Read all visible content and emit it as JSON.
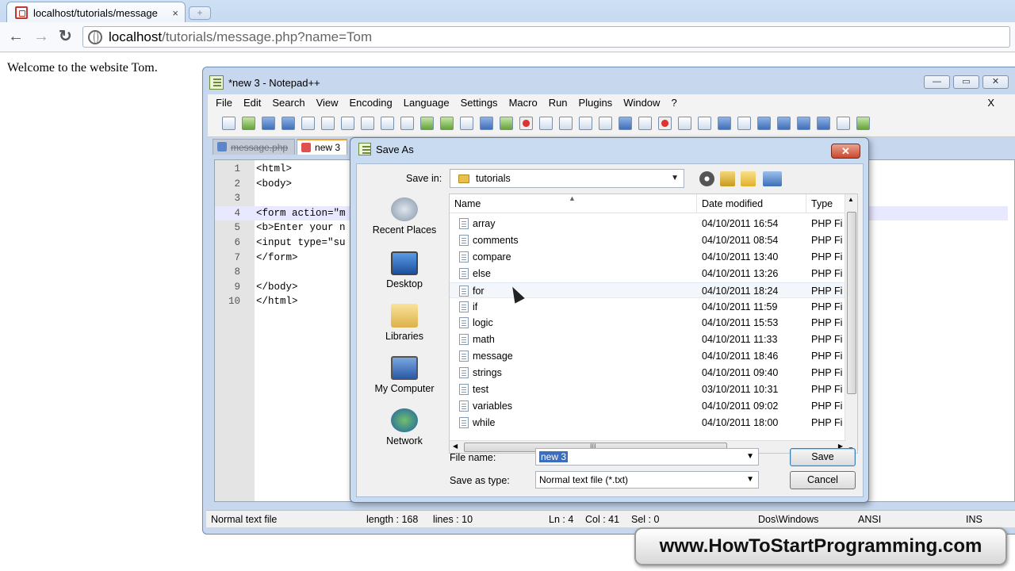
{
  "browser": {
    "tab_title": "localhost/tutorials/message",
    "tab_close": "×",
    "new_tab": "+",
    "back": "←",
    "forward": "→",
    "reload": "↻",
    "url_host": "localhost",
    "url_path": "/tutorials/message.php?name=Tom"
  },
  "page": {
    "welcome": "Welcome to the website Tom."
  },
  "npp": {
    "title": "*new 3 - Notepad++",
    "win_min": "—",
    "win_max": "▭",
    "win_close": "✕",
    "menu": [
      "File",
      "Edit",
      "Search",
      "View",
      "Encoding",
      "Language",
      "Settings",
      "Macro",
      "Run",
      "Plugins",
      "Window",
      "?"
    ],
    "menu_close": "X",
    "tabs": [
      {
        "label": "message.php"
      },
      {
        "label": "new 3"
      }
    ],
    "lines": [
      {
        "n": "1",
        "code": "<html>"
      },
      {
        "n": "2",
        "code": "<body>"
      },
      {
        "n": "3",
        "code": ""
      },
      {
        "n": "4",
        "code": "<form action=\"m"
      },
      {
        "n": "5",
        "code": "<b>Enter your n"
      },
      {
        "n": "6",
        "code": "<input type=\"su"
      },
      {
        "n": "7",
        "code": "</form>"
      },
      {
        "n": "8",
        "code": ""
      },
      {
        "n": "9",
        "code": "</body>"
      },
      {
        "n": "10",
        "code": "</html>"
      }
    ],
    "status": {
      "type": "Normal text file",
      "length": "length : 168",
      "lines": "lines : 10",
      "ln": "Ln : 4",
      "col": "Col : 41",
      "sel": "Sel : 0",
      "eol": "Dos\\Windows",
      "enc": "ANSI",
      "mode": "INS"
    }
  },
  "dialog": {
    "title": "Save As",
    "close": "✕",
    "save_in_label": "Save in:",
    "save_in_value": "tutorials",
    "places": [
      "Recent Places",
      "Desktop",
      "Libraries",
      "My Computer",
      "Network"
    ],
    "columns": {
      "name": "Name",
      "date": "Date modified",
      "type": "Type"
    },
    "files": [
      {
        "name": "array",
        "date": "04/10/2011 16:54",
        "type": "PHP Fi"
      },
      {
        "name": "comments",
        "date": "04/10/2011 08:54",
        "type": "PHP Fi"
      },
      {
        "name": "compare",
        "date": "04/10/2011 13:40",
        "type": "PHP Fi"
      },
      {
        "name": "else",
        "date": "04/10/2011 13:26",
        "type": "PHP Fi"
      },
      {
        "name": "for",
        "date": "04/10/2011 18:24",
        "type": "PHP Fi"
      },
      {
        "name": "if",
        "date": "04/10/2011 11:59",
        "type": "PHP Fi"
      },
      {
        "name": "logic",
        "date": "04/10/2011 15:53",
        "type": "PHP Fi"
      },
      {
        "name": "math",
        "date": "04/10/2011 11:33",
        "type": "PHP Fi"
      },
      {
        "name": "message",
        "date": "04/10/2011 18:46",
        "type": "PHP Fi"
      },
      {
        "name": "strings",
        "date": "04/10/2011 09:40",
        "type": "PHP Fi"
      },
      {
        "name": "test",
        "date": "03/10/2011 10:31",
        "type": "PHP Fi"
      },
      {
        "name": "variables",
        "date": "04/10/2011 09:02",
        "type": "PHP Fi"
      },
      {
        "name": "while",
        "date": "04/10/2011 18:00",
        "type": "PHP Fi"
      }
    ],
    "file_name_label": "File name:",
    "file_name_value": "new  3",
    "save_type_label": "Save as type:",
    "save_type_value": "Normal text file (*.txt)",
    "save_button": "Save",
    "cancel_button": "Cancel",
    "scroll_grip": "III"
  },
  "watermark": "www.HowToStartProgramming.com"
}
